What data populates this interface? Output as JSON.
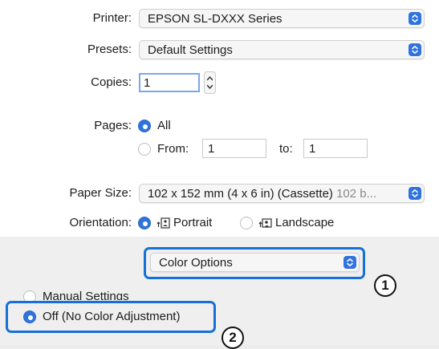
{
  "printer": {
    "label": "Printer:",
    "value": "EPSON SL-DXXX Series"
  },
  "presets": {
    "label": "Presets:",
    "value": "Default Settings"
  },
  "copies": {
    "label": "Copies:",
    "value": "1"
  },
  "pages": {
    "label": "Pages:",
    "all_label": "All",
    "from_label": "From:",
    "from_value": "1",
    "to_label": "to:",
    "to_value": "1"
  },
  "paper_size": {
    "label": "Paper Size:",
    "value": "102 x 152 mm (4 x 6 in) (Cassette)",
    "hint": "102 b..."
  },
  "orientation": {
    "label": "Orientation:",
    "portrait": "Portrait",
    "landscape": "Landscape"
  },
  "color_options": {
    "value": "Color Options"
  },
  "color_mode": {
    "manual": "Manual Settings",
    "off": "Off (No Color Adjustment)"
  },
  "callouts": {
    "one": "1",
    "two": "2"
  },
  "colors": {
    "accent": "#2f73de",
    "callout_border": "#1570d8",
    "panel_bg": "#ffffff",
    "lower_bg": "#efefef"
  }
}
